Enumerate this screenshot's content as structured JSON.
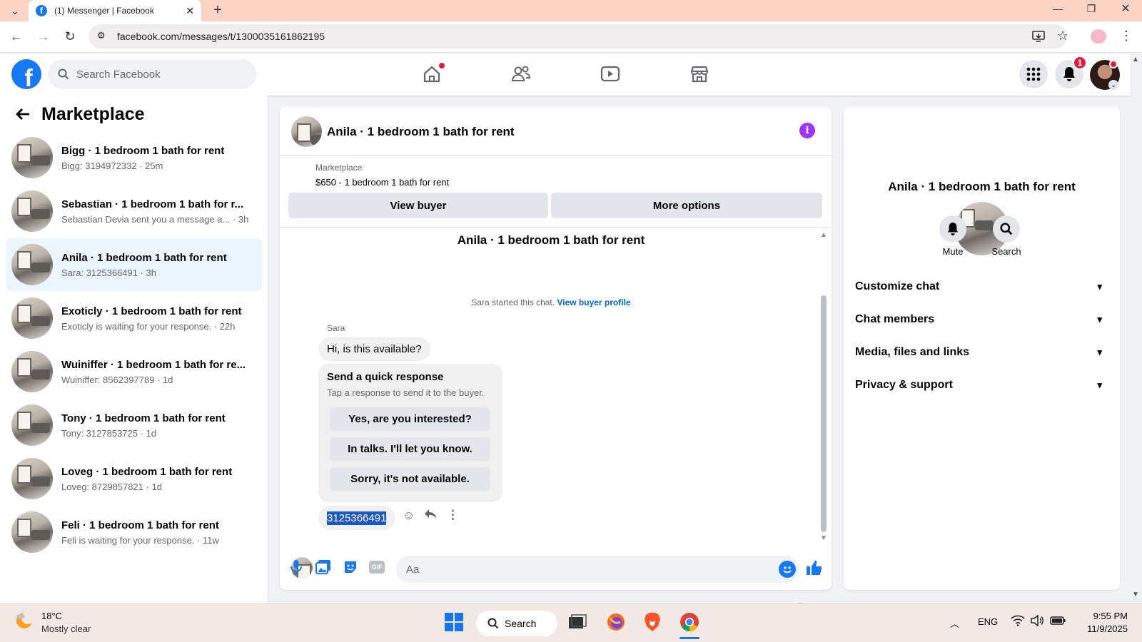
{
  "browser": {
    "tab_title": "(1) Messenger | Facebook",
    "url": "facebook.com/messages/t/1300035161862195"
  },
  "fb": {
    "logo": "f",
    "search_placeholder": "Search Facebook",
    "notification_count": "1",
    "nav_icons": [
      "home-icon",
      "friends-icon",
      "watch-icon",
      "marketplace-icon"
    ]
  },
  "sidebar": {
    "title": "Marketplace",
    "conversations": [
      {
        "name": "Bigg · 1 bedroom 1 bath for rent",
        "sub": "Bigg: 3194972332 · 25m"
      },
      {
        "name": "Sebastian · 1 bedroom 1 bath for r...",
        "sub": "Sebastian Devia sent you a message a... · 3h"
      },
      {
        "name": "Anila · 1 bedroom 1 bath for rent",
        "sub": "Sara: 3125366491 · 3h"
      },
      {
        "name": "Exoticly · 1 bedroom 1 bath for rent",
        "sub": "Exoticly is waiting for your response. · 22h"
      },
      {
        "name": "Wuiniffer · 1 bedroom 1 bath for re...",
        "sub": "Wuiniffer: 8562397789 · 1d"
      },
      {
        "name": "Tony · 1 bedroom 1 bath for rent",
        "sub": "Tony: 3127853725 · 1d"
      },
      {
        "name": "Loveg · 1 bedroom 1 bath for rent",
        "sub": "Loveg: 8729857821 · 1d"
      },
      {
        "name": "Feli · 1 bedroom 1 bath for rent",
        "sub": "Feli is waiting for your response. · 11w"
      }
    ]
  },
  "chat": {
    "title": "Anila · 1 bedroom 1 bath for rent",
    "listing_label": "Marketplace",
    "listing_price": "$650 - 1 bedroom 1 bath for rent",
    "view_buyer": "View buyer",
    "more_options": "More options",
    "thread_heading": "Anila · 1 bedroom 1 bath for rent",
    "started_text": "Sara started this chat.",
    "view_profile": "View buyer profile",
    "sender_name": "Sara",
    "message_1": "Hi, is this available?",
    "quick_title": "Send a quick response",
    "quick_sub": "Tap a response to send it to the buyer.",
    "quick_responses": [
      "Yes, are you interested?",
      "In talks. I'll let you know.",
      "Sorry, it's not available."
    ],
    "message_2": "3125366491",
    "composer_placeholder": "Aa",
    "gif_label": "GIF"
  },
  "details": {
    "name": "Anila · 1 bedroom 1 bath for rent",
    "mute": "Mute",
    "search": "Search",
    "sections": [
      "Customize chat",
      "Chat members",
      "Media, files and links",
      "Privacy & support"
    ]
  },
  "taskbar": {
    "temp": "18°C",
    "weather": "Mostly clear",
    "search": "Search",
    "lang": "ENG",
    "time": "9:55 PM",
    "date": "11/9/2025"
  },
  "colors": {
    "fb_blue": "#1877f2",
    "accent_purple": "#a033ff",
    "link_blue": "#0064d1"
  }
}
